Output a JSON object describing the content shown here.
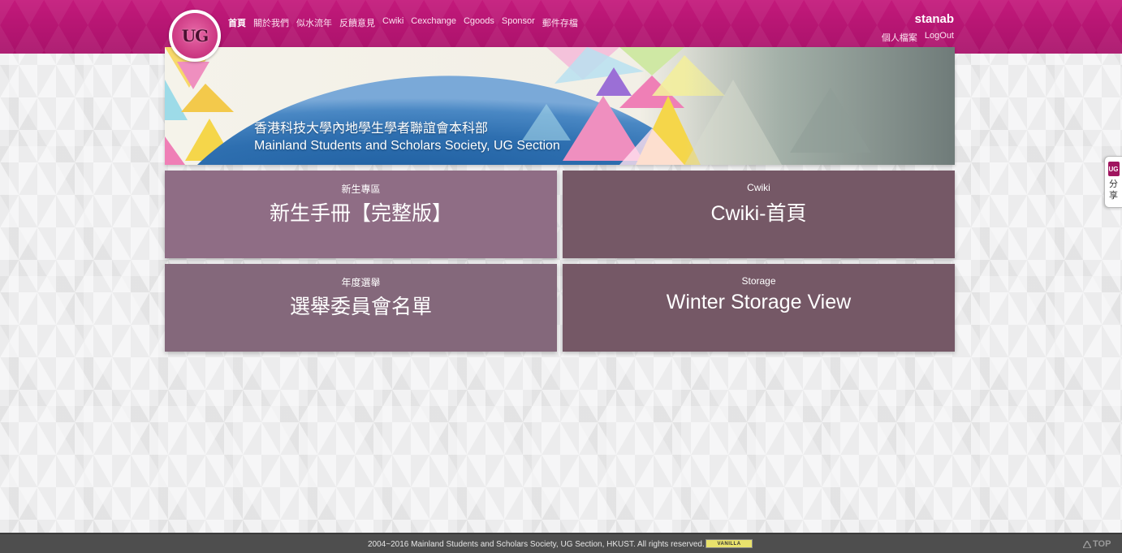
{
  "header": {
    "logo_text": "UG",
    "nav": [
      {
        "label": "首頁",
        "active": true
      },
      {
        "label": "關於我們"
      },
      {
        "label": "似水流年"
      },
      {
        "label": "反饋意見"
      },
      {
        "label": "Cwiki"
      },
      {
        "label": "Cexchange"
      },
      {
        "label": "Cgoods"
      },
      {
        "label": "Sponsor"
      },
      {
        "label": "郵件存檔"
      }
    ],
    "username": "stanab",
    "user_links": {
      "profile": "個人檔案",
      "logout": "LogOut"
    }
  },
  "banner": {
    "title_cn": "香港科技大學內地學生學者聯誼會本科部",
    "title_en": "Mainland Students and Scholars Society, UG Section"
  },
  "tiles": [
    {
      "category": "新生專區",
      "title": "新生手冊【完整版】"
    },
    {
      "category": "Cwiki",
      "title": "Cwiki-首頁"
    },
    {
      "category": "年度選舉",
      "title": "選舉委員會名單"
    },
    {
      "category": "Storage",
      "title": "Winter Storage View"
    }
  ],
  "share": {
    "logo": "UG",
    "label": "分享"
  },
  "footer": {
    "copyright": "2004~2016 Mainland Students and Scholars Society, UG Section, HKUST. All rights reserved.",
    "badge": "VANILLA",
    "top_label": "TOP"
  },
  "colors": {
    "header_pink": "#b5156f",
    "tile_light": "#8f6d85",
    "tile_dark": "#755866",
    "footer": "#4e4e4e"
  }
}
